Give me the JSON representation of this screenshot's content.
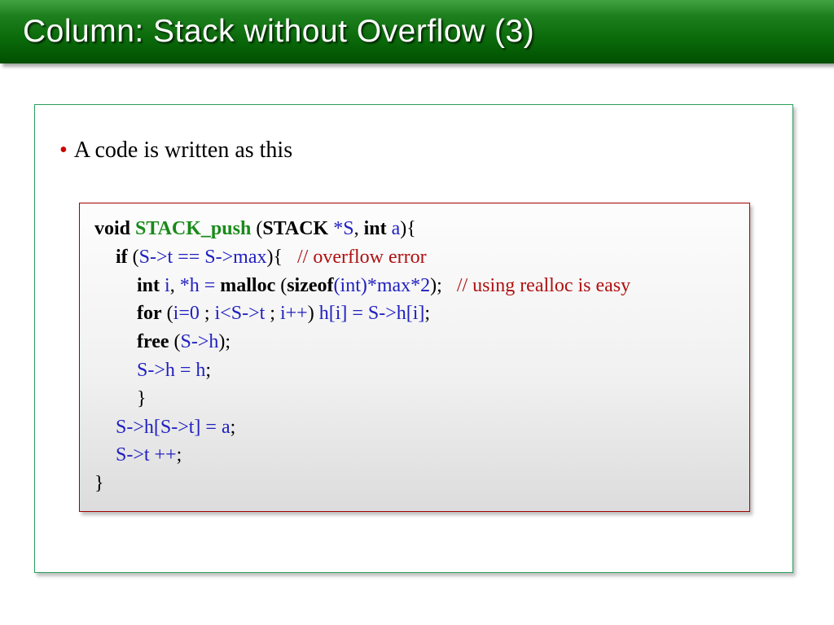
{
  "title": "Column: Stack without Overflow (3)",
  "bullet_text": "A code is written as this",
  "code": {
    "l1": {
      "kw1": "void",
      "fn": " STACK_push",
      "pl1": " (",
      "kw2": "STACK",
      "var1": " *S",
      "pl2": ", ",
      "kw3": "int",
      "var2": " a",
      "pl3": "){"
    },
    "l2": {
      "kw1": "if",
      "pl1": " (",
      "expr": "S->t == S->max",
      "pl2": "){   ",
      "cmt": "// overflow error"
    },
    "l3": {
      "kw1": "int",
      "var1": " i",
      "pl1": ", ",
      "var2": "*h =",
      "pl1b": " ",
      "kw2": "malloc",
      "pl2": " (",
      "kw3": "sizeof",
      "arg": "(int)*max*2",
      "pl3": ");   ",
      "cmt": "// using realloc is easy"
    },
    "l4": {
      "kw1": "for",
      "pl1": " (",
      "p1": "i=0",
      "pl2": " ; ",
      "p2": "i<S->t",
      "pl3": " ; ",
      "p3": "i++",
      "pl4": ") ",
      "body": "h[i] = S->h[i]",
      "pl5": ";"
    },
    "l5": {
      "kw1": "free",
      "pl1": " (",
      "arg": "S->h",
      "pl2": ");"
    },
    "l6": {
      "body": "S->h = h",
      "pl": ";"
    },
    "l7": {
      "pl": "}"
    },
    "l8": {
      "body": "S->h[S->t] = a",
      "pl": ";"
    },
    "l9": {
      "body": "S->t ++",
      "pl": ";"
    },
    "l10": {
      "pl": "}"
    }
  }
}
